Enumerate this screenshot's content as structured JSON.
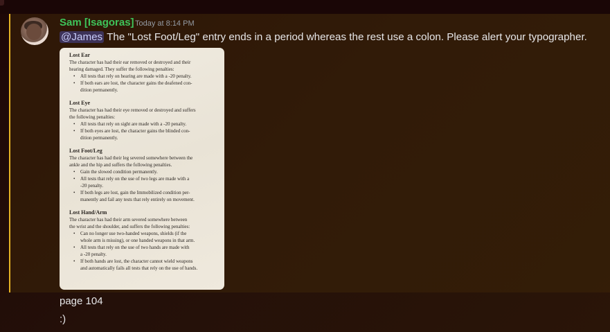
{
  "message": {
    "author": "Sam [Isagoras]",
    "timestamp": "Today at 8:14 PM",
    "mention": "@James",
    "text": "The \"Lost Foot/Leg\" entry ends in a period whereas the rest use a colon. Please alert your typographer."
  },
  "attachment": {
    "sections": [
      {
        "title": "Lost Ear",
        "desc": [
          "The character has had their ear removed or destroyed and their",
          "hearing damaged. They suffer the following penalties:"
        ],
        "bullets": [
          [
            "All tests that rely on hearing are made with a -20 penalty."
          ],
          [
            "If both ears are lost, the character gains the deafened con-",
            "dition permanently."
          ]
        ]
      },
      {
        "title": "Lost Eye",
        "desc": [
          "The character has had their eye removed or destroyed and suffers",
          "the following penalties:"
        ],
        "bullets": [
          [
            "All tests that rely on sight are made with a -20 penalty."
          ],
          [
            "If both eyes are lost, the character gains the blinded con-",
            "dition permanently."
          ]
        ]
      },
      {
        "title": "Lost Foot/Leg",
        "desc": [
          "The character has had their leg severed somewhere between the",
          "ankle and the hip and suffers the following penalties."
        ],
        "bullets": [
          [
            "Gain the slowed condition permanently."
          ],
          [
            "All tests that rely on the use of two legs are made with a",
            "-20 penalty."
          ],
          [
            "If both legs are lost, gain the Immobilized condition per-",
            "manently and fail any tests that rely entirely on movement."
          ]
        ]
      },
      {
        "title": "Lost Hand/Arm",
        "desc": [
          "The character has had their arm severed somewhere between",
          "the wrist and the shoulder, and suffers the following penalties:"
        ],
        "bullets": [
          [
            "Can no longer use two-handed weapons, shields (if the",
            "whole arm is missing), or one handed weapons in that arm."
          ],
          [
            "All tests that rely on the use of two hands are made with",
            "a -20 penalty."
          ],
          [
            "If both hands are lost, the character cannot wield weapons",
            "and automatically fails all tests that rely on the use of hands."
          ]
        ]
      }
    ]
  },
  "followups": [
    {
      "text": "page 104"
    },
    {
      "text": ":)"
    }
  ],
  "colors": {
    "accent": "#e6b325",
    "author": "#3ec35a",
    "mention_bg": "#5865f2"
  }
}
